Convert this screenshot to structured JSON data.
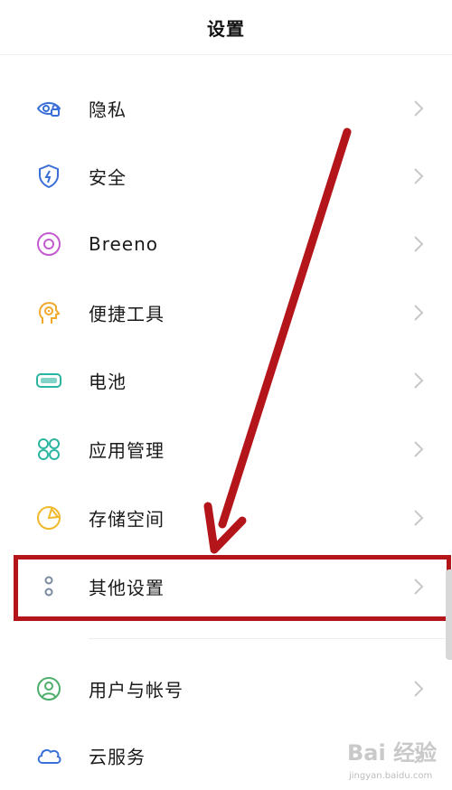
{
  "header": {
    "title": "设置"
  },
  "settings": [
    {
      "label": "隐私"
    },
    {
      "label": "安全"
    },
    {
      "label": "Breeno"
    },
    {
      "label": "便捷工具"
    },
    {
      "label": "电池"
    },
    {
      "label": "应用管理"
    },
    {
      "label": "存储空间"
    },
    {
      "label": "其他设置"
    },
    {
      "label": "用户与帐号"
    },
    {
      "label": "云服务"
    }
  ],
  "icons": [
    "privacy-icon",
    "shield-icon",
    "breeno-icon",
    "tools-icon",
    "battery-icon",
    "apps-icon",
    "storage-icon",
    "more-icon",
    "user-icon",
    "cloud-icon"
  ],
  "colors": {
    "annotation_red": "#b3151a",
    "privacy": "#3b6fd8",
    "security": "#3b6fd8",
    "breeno": "#c35bd0",
    "tools": "#f0a92b",
    "battery": "#2bb5a0",
    "apps": "#2bb5a0",
    "storage": "#f0b92b",
    "more": "#7a8aa0",
    "user": "#4cae6a",
    "cloud": "#3b6fd8"
  },
  "watermark": {
    "brand": "Bai 经验",
    "url": "jingyan.baidu.com"
  }
}
